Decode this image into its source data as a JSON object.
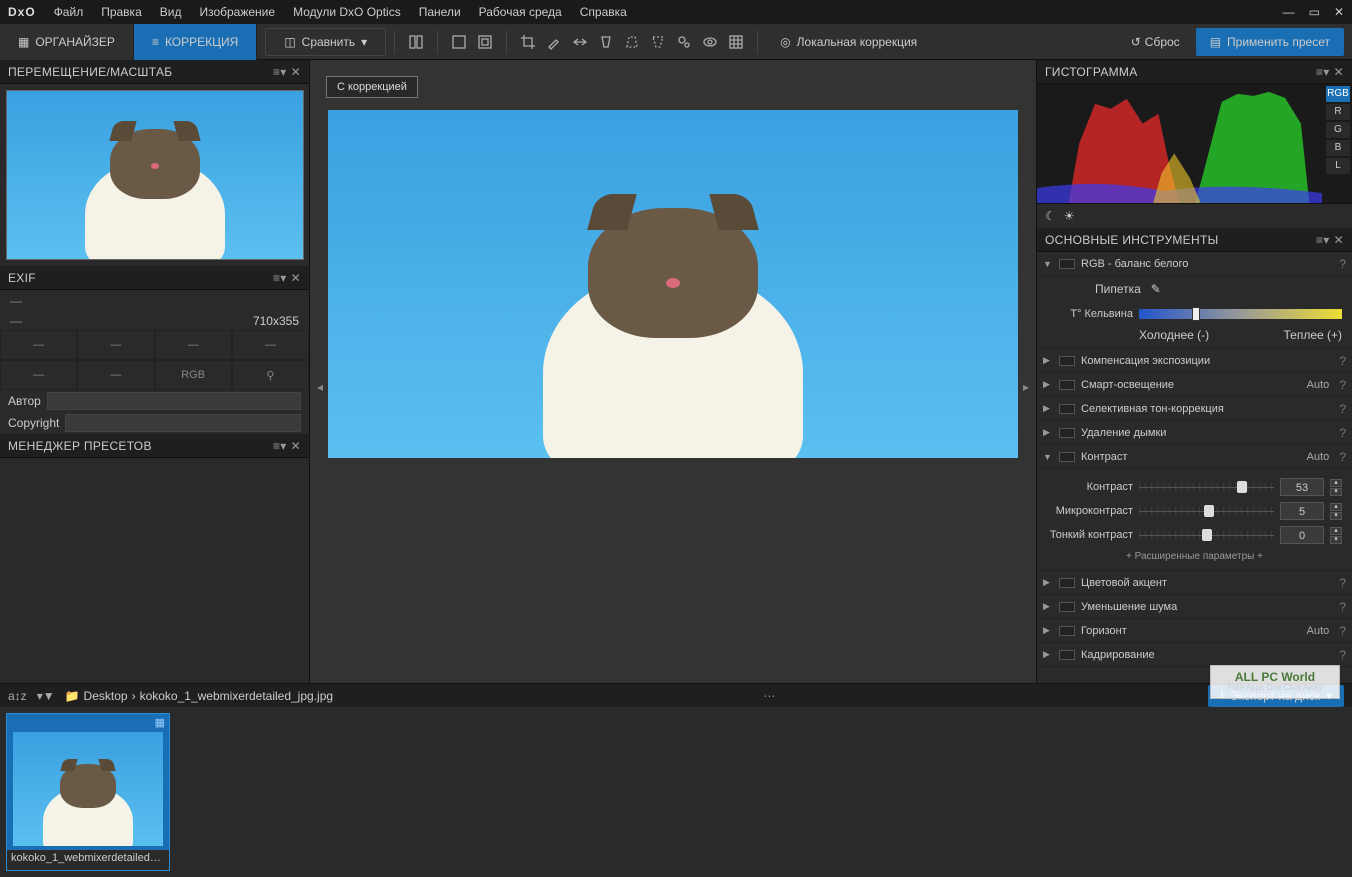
{
  "menu": {
    "logo": "DxO",
    "items": [
      "Файл",
      "Правка",
      "Вид",
      "Изображение",
      "Модули DxO Optics",
      "Панели",
      "Рабочая среда",
      "Справка"
    ]
  },
  "tabs": {
    "organizer": "ОРГАНАЙЗЕР",
    "correction": "КОРРЕКЦИЯ",
    "compare": "Сравнить"
  },
  "toolbar": {
    "local_correction": "Локальная коррекция",
    "reset": "Сброс",
    "apply_preset": "Применить пресет"
  },
  "left": {
    "move_zoom": "ПЕРЕМЕЩЕНИЕ/МАСШТАБ",
    "exif": "EXIF",
    "dimensions": "710x355",
    "dash": "—",
    "rgb": "RGB",
    "author": "Автор",
    "copyright": "Copyright",
    "preset_mgr": "МЕНЕДЖЕР ПРЕСЕТОВ"
  },
  "center": {
    "with_correction": "С коррекцией"
  },
  "right": {
    "histogram": "ГИСТОГРАММА",
    "chan": [
      "RGB",
      "R",
      "G",
      "B",
      "L"
    ],
    "main_tools": "ОСНОВНЫЕ ИНСТРУМЕНТЫ",
    "wb": "RGB - баланс белого",
    "pipette": "Пипетка",
    "kelvin": "Т° Кельвина",
    "colder": "Холоднее (-)",
    "warmer": "Теплее (+)",
    "exposure_comp": "Компенсация экспозиции",
    "smart_light": "Смарт-освещение",
    "selective_tone": "Селективная тон-коррекция",
    "haze": "Удаление дымки",
    "contrast": "Контраст",
    "contrast_lbl": "Контраст",
    "micro": "Микроконтраст",
    "fine": "Тонкий контраст",
    "contrast_val": "53",
    "micro_val": "5",
    "fine_val": "0",
    "advanced": "+ Расширенные параметры +",
    "auto": "Auto",
    "color_accent": "Цветовой акцент",
    "noise": "Уменьшение шума",
    "horizon": "Горизонт",
    "crop": "Кадрирование",
    "q": "?"
  },
  "pathbar": {
    "desktop": "Desktop",
    "file": "kokoko_1_webmixerdetailed_jpg.jpg",
    "export": "Экспорт на диск"
  },
  "filmstrip": {
    "thumb_name": "kokoko_1_webmixerdetailed_j..."
  },
  "watermark": {
    "l1": "ALL PC World",
    "l2": "Free Apps One Click Away"
  }
}
